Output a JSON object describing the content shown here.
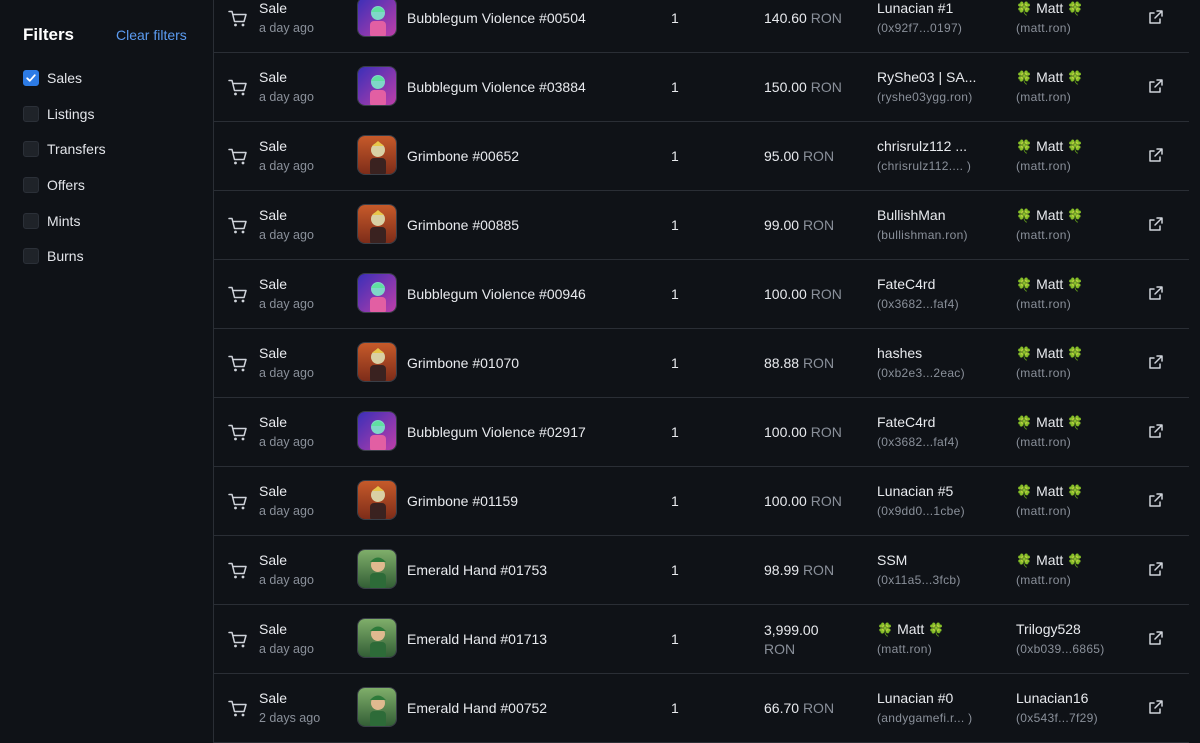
{
  "sidebar": {
    "title": "Filters",
    "clear_label": "Clear filters",
    "options": [
      {
        "label": "Sales",
        "checked": true
      },
      {
        "label": "Listings",
        "checked": false
      },
      {
        "label": "Transfers",
        "checked": false
      },
      {
        "label": "Offers",
        "checked": false
      },
      {
        "label": "Mints",
        "checked": false
      },
      {
        "label": "Burns",
        "checked": false
      }
    ]
  },
  "colors": {
    "accent": "#2d7be5",
    "link": "#5b9bf0",
    "background": "#0f1217",
    "muted": "#8a909a",
    "clover": "#46c46a"
  },
  "activity": [
    {
      "type": "Sale",
      "time": "a day ago",
      "item": "Bubblegum Violence #00504",
      "qty": "1",
      "price": "140.60",
      "unit": "RON",
      "from": "Lunacian #1",
      "from_addr": "(0x92f7...0197)",
      "to": "🍀 Matt 🍀",
      "to_addr": "(matt.ron)",
      "thumb": "bubblegum"
    },
    {
      "type": "Sale",
      "time": "a day ago",
      "item": "Bubblegum Violence #03884",
      "qty": "1",
      "price": "150.00",
      "unit": "RON",
      "from": "RyShe03 | SA...",
      "from_addr": "(ryshe03ygg.ron)",
      "to": "🍀 Matt 🍀",
      "to_addr": "(matt.ron)",
      "thumb": "bubblegum"
    },
    {
      "type": "Sale",
      "time": "a day ago",
      "item": "Grimbone #00652",
      "qty": "1",
      "price": "95.00",
      "unit": "RON",
      "from": "chrisrulz112 ...",
      "from_addr": "(chrisrulz112.... )",
      "to": "🍀 Matt 🍀",
      "to_addr": "(matt.ron)",
      "thumb": "grimbone"
    },
    {
      "type": "Sale",
      "time": "a day ago",
      "item": "Grimbone #00885",
      "qty": "1",
      "price": "99.00",
      "unit": "RON",
      "from": "BullishMan",
      "from_addr": "(bullishman.ron)",
      "to": "🍀 Matt 🍀",
      "to_addr": "(matt.ron)",
      "thumb": "grimbone"
    },
    {
      "type": "Sale",
      "time": "a day ago",
      "item": "Bubblegum Violence #00946",
      "qty": "1",
      "price": "100.00",
      "unit": "RON",
      "from": "FateC4rd",
      "from_addr": "(0x3682...faf4)",
      "to": "🍀 Matt 🍀",
      "to_addr": "(matt.ron)",
      "thumb": "bubblegum"
    },
    {
      "type": "Sale",
      "time": "a day ago",
      "item": "Grimbone #01070",
      "qty": "1",
      "price": "88.88",
      "unit": "RON",
      "from": "hashes",
      "from_addr": "(0xb2e3...2eac)",
      "to": "🍀 Matt 🍀",
      "to_addr": "(matt.ron)",
      "thumb": "grimbone"
    },
    {
      "type": "Sale",
      "time": "a day ago",
      "item": "Bubblegum Violence #02917",
      "qty": "1",
      "price": "100.00",
      "unit": "RON",
      "from": "FateC4rd",
      "from_addr": "(0x3682...faf4)",
      "to": "🍀 Matt 🍀",
      "to_addr": "(matt.ron)",
      "thumb": "bubblegum"
    },
    {
      "type": "Sale",
      "time": "a day ago",
      "item": "Grimbone #01159",
      "qty": "1",
      "price": "100.00",
      "unit": "RON",
      "from": "Lunacian #5",
      "from_addr": "(0x9dd0...1cbe)",
      "to": "🍀 Matt 🍀",
      "to_addr": "(matt.ron)",
      "thumb": "grimbone"
    },
    {
      "type": "Sale",
      "time": "a day ago",
      "item": "Emerald Hand #01753",
      "qty": "1",
      "price": "98.99",
      "unit": "RON",
      "from": "SSM",
      "from_addr": "(0x11a5...3fcb)",
      "to": "🍀 Matt 🍀",
      "to_addr": "(matt.ron)",
      "thumb": "emerald"
    },
    {
      "type": "Sale",
      "time": "a day ago",
      "item": "Emerald Hand #01713",
      "qty": "1",
      "price": "3,999.00",
      "unit": "RON",
      "price_wrap": true,
      "from": "🍀 Matt 🍀",
      "from_addr": "(matt.ron)",
      "to": "Trilogy528",
      "to_addr": "(0xb039...6865)",
      "thumb": "emerald"
    },
    {
      "type": "Sale",
      "time": "2 days ago",
      "item": "Emerald Hand #00752",
      "qty": "1",
      "price": "66.70",
      "unit": "RON",
      "from": "Lunacian #0",
      "from_addr": "(andygamefi.r... )",
      "to": "Lunacian16",
      "to_addr": "(0x543f...7f29)",
      "thumb": "emerald"
    }
  ]
}
